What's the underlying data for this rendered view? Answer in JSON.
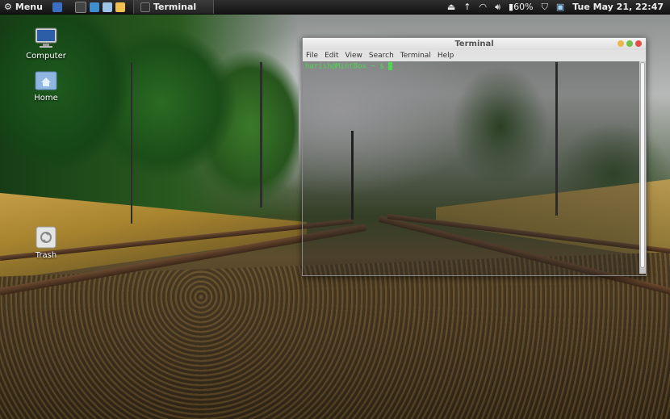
{
  "panel": {
    "menu_label": "Menu",
    "task_title": "Terminal",
    "battery": "60%",
    "clock": "Tue May 21, 22:47"
  },
  "desktop": {
    "computer": "Computer",
    "home": "Home",
    "trash": "Trash"
  },
  "terminal": {
    "title": "Terminal",
    "menu": [
      "File",
      "Edit",
      "View",
      "Search",
      "Terminal",
      "Help"
    ],
    "prompt": "harish@MintBox ~ $"
  },
  "colors": {
    "prompt": "#4cd84c",
    "close": "#e0504a",
    "minimize": "#e8b84a",
    "maximize": "#6fbf4b"
  }
}
